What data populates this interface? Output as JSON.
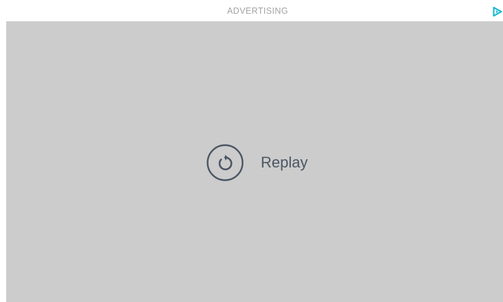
{
  "ad": {
    "label": "ADVERTISING",
    "adchoices_icon": "adchoices-triangle-icon",
    "accent_color": "#1fb8d4"
  },
  "player": {
    "background_color": "#cccccc",
    "replay_icon": "replay-icon",
    "replay_label": "Replay",
    "text_color": "#4b5663"
  }
}
